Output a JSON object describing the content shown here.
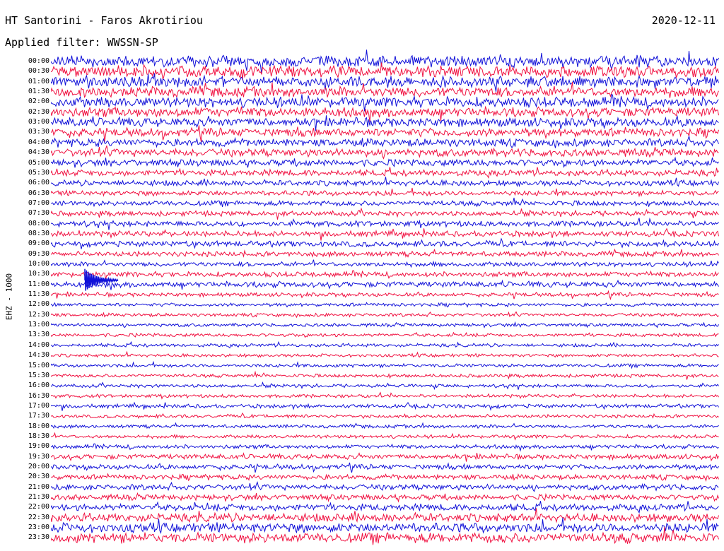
{
  "header": {
    "station": "HT Santorini - Faros Akrotiriou",
    "date": "2020-12-11",
    "filter": "Applied filter: WWSSN-SP"
  },
  "channel_label": "EHZ - 1000",
  "colors": {
    "blue": "#1010d8",
    "red": "#f01040",
    "background": "#ffffff"
  },
  "chart_data": {
    "type": "line",
    "title": "HT Santorini - Faros Akrotiriou",
    "subtitle": "Applied filter: WWSSN-SP",
    "ylabel": "EHZ - 1000",
    "row_labels": [
      "00:00",
      "00:30",
      "01:00",
      "01:30",
      "02:00",
      "02:30",
      "03:00",
      "03:30",
      "04:00",
      "04:30",
      "05:00",
      "05:30",
      "06:00",
      "06:30",
      "07:00",
      "07:30",
      "08:00",
      "08:30",
      "09:00",
      "09:30",
      "10:00",
      "10:30",
      "11:00",
      "11:30",
      "12:00",
      "12:30",
      "13:00",
      "13:30",
      "14:00",
      "14:30",
      "15:00",
      "15:30",
      "16:00",
      "16:30",
      "17:00",
      "17:30",
      "18:00",
      "18:30",
      "19:00",
      "19:30",
      "20:00",
      "20:30",
      "21:00",
      "21:30",
      "22:00",
      "22:30",
      "23:00",
      "23:30"
    ],
    "row_colors": [
      "blue",
      "red"
    ],
    "relative_amplitude": [
      1.0,
      1.0,
      0.95,
      0.9,
      0.9,
      0.85,
      0.8,
      0.75,
      0.7,
      0.7,
      0.6,
      0.55,
      0.5,
      0.45,
      0.45,
      0.45,
      0.5,
      0.5,
      0.5,
      0.45,
      0.4,
      0.45,
      0.5,
      0.35,
      0.3,
      0.3,
      0.3,
      0.3,
      0.3,
      0.28,
      0.3,
      0.3,
      0.3,
      0.3,
      0.35,
      0.3,
      0.3,
      0.3,
      0.35,
      0.45,
      0.45,
      0.45,
      0.5,
      0.5,
      0.6,
      0.75,
      0.85,
      0.9
    ],
    "events": [
      {
        "row": "11:00",
        "note": ""
      }
    ]
  }
}
